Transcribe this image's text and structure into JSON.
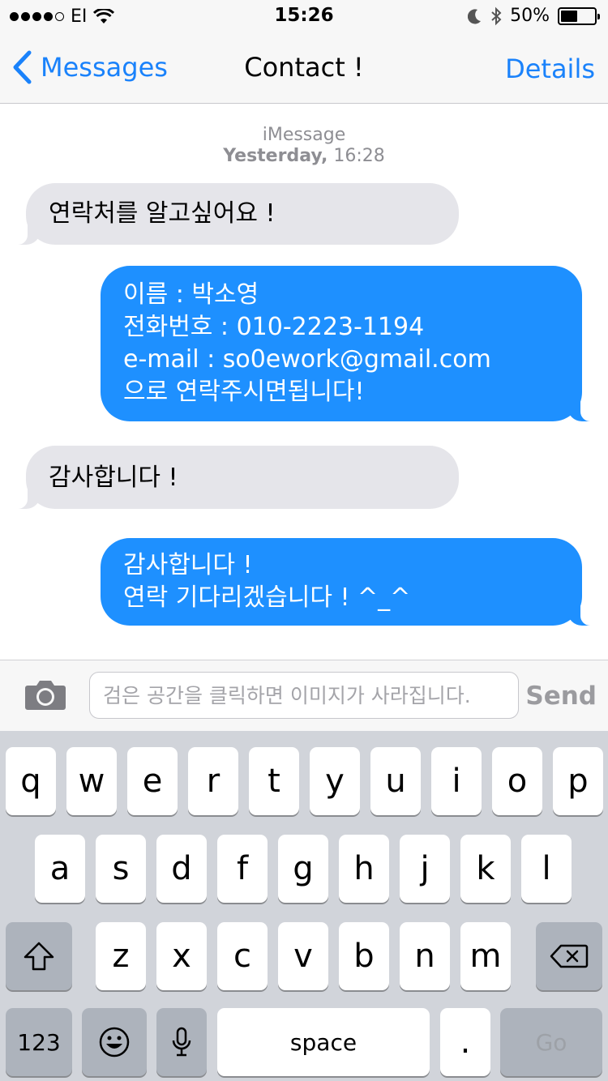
{
  "status_bar": {
    "carrier": "EI",
    "time": "15:26",
    "battery_text": "50%",
    "battery_level": 0.5,
    "icons": [
      "signal-dots-icon",
      "wifi-icon",
      "moon-icon",
      "bluetooth-icon",
      "battery-icon"
    ]
  },
  "nav": {
    "back_label": "Messages",
    "title": "Contact !",
    "details_label": "Details"
  },
  "thread": {
    "service": "iMessage",
    "timestamp_day": "Yesterday,",
    "timestamp_time": "16:28",
    "messages": [
      {
        "direction": "incoming",
        "lines": [
          "연락처를 알고싶어요 !"
        ]
      },
      {
        "direction": "outgoing",
        "lines": [
          "이름 : 박소영",
          "전화번호 : 010-2223-1194",
          "e-mail : so0ework@gmail.com",
          "으로 연락주시면됩니다!"
        ]
      },
      {
        "direction": "incoming",
        "lines": [
          "감사합니다 !"
        ]
      },
      {
        "direction": "outgoing",
        "lines": [
          "감사합니다 !",
          "연락 기다리겠습니다 ! ^_^"
        ]
      }
    ]
  },
  "composer": {
    "placeholder": "검은 공간을 클릭하면 이미지가 사라집니다.",
    "value": "",
    "send_label": "Send"
  },
  "keyboard": {
    "row1": [
      "q",
      "w",
      "e",
      "r",
      "t",
      "y",
      "u",
      "i",
      "o",
      "p"
    ],
    "row2": [
      "a",
      "s",
      "d",
      "f",
      "g",
      "h",
      "j",
      "k",
      "l"
    ],
    "row3": [
      "z",
      "x",
      "c",
      "v",
      "b",
      "n",
      "m"
    ],
    "numbers_label": "123",
    "space_label": "space",
    "period_label": ".",
    "go_label": "Go"
  },
  "colors": {
    "accent": "#1a82fb",
    "outgoing_bubble": "#1e90ff",
    "incoming_bubble": "#e5e5ea",
    "keyboard_bg": "#d1d4da"
  }
}
